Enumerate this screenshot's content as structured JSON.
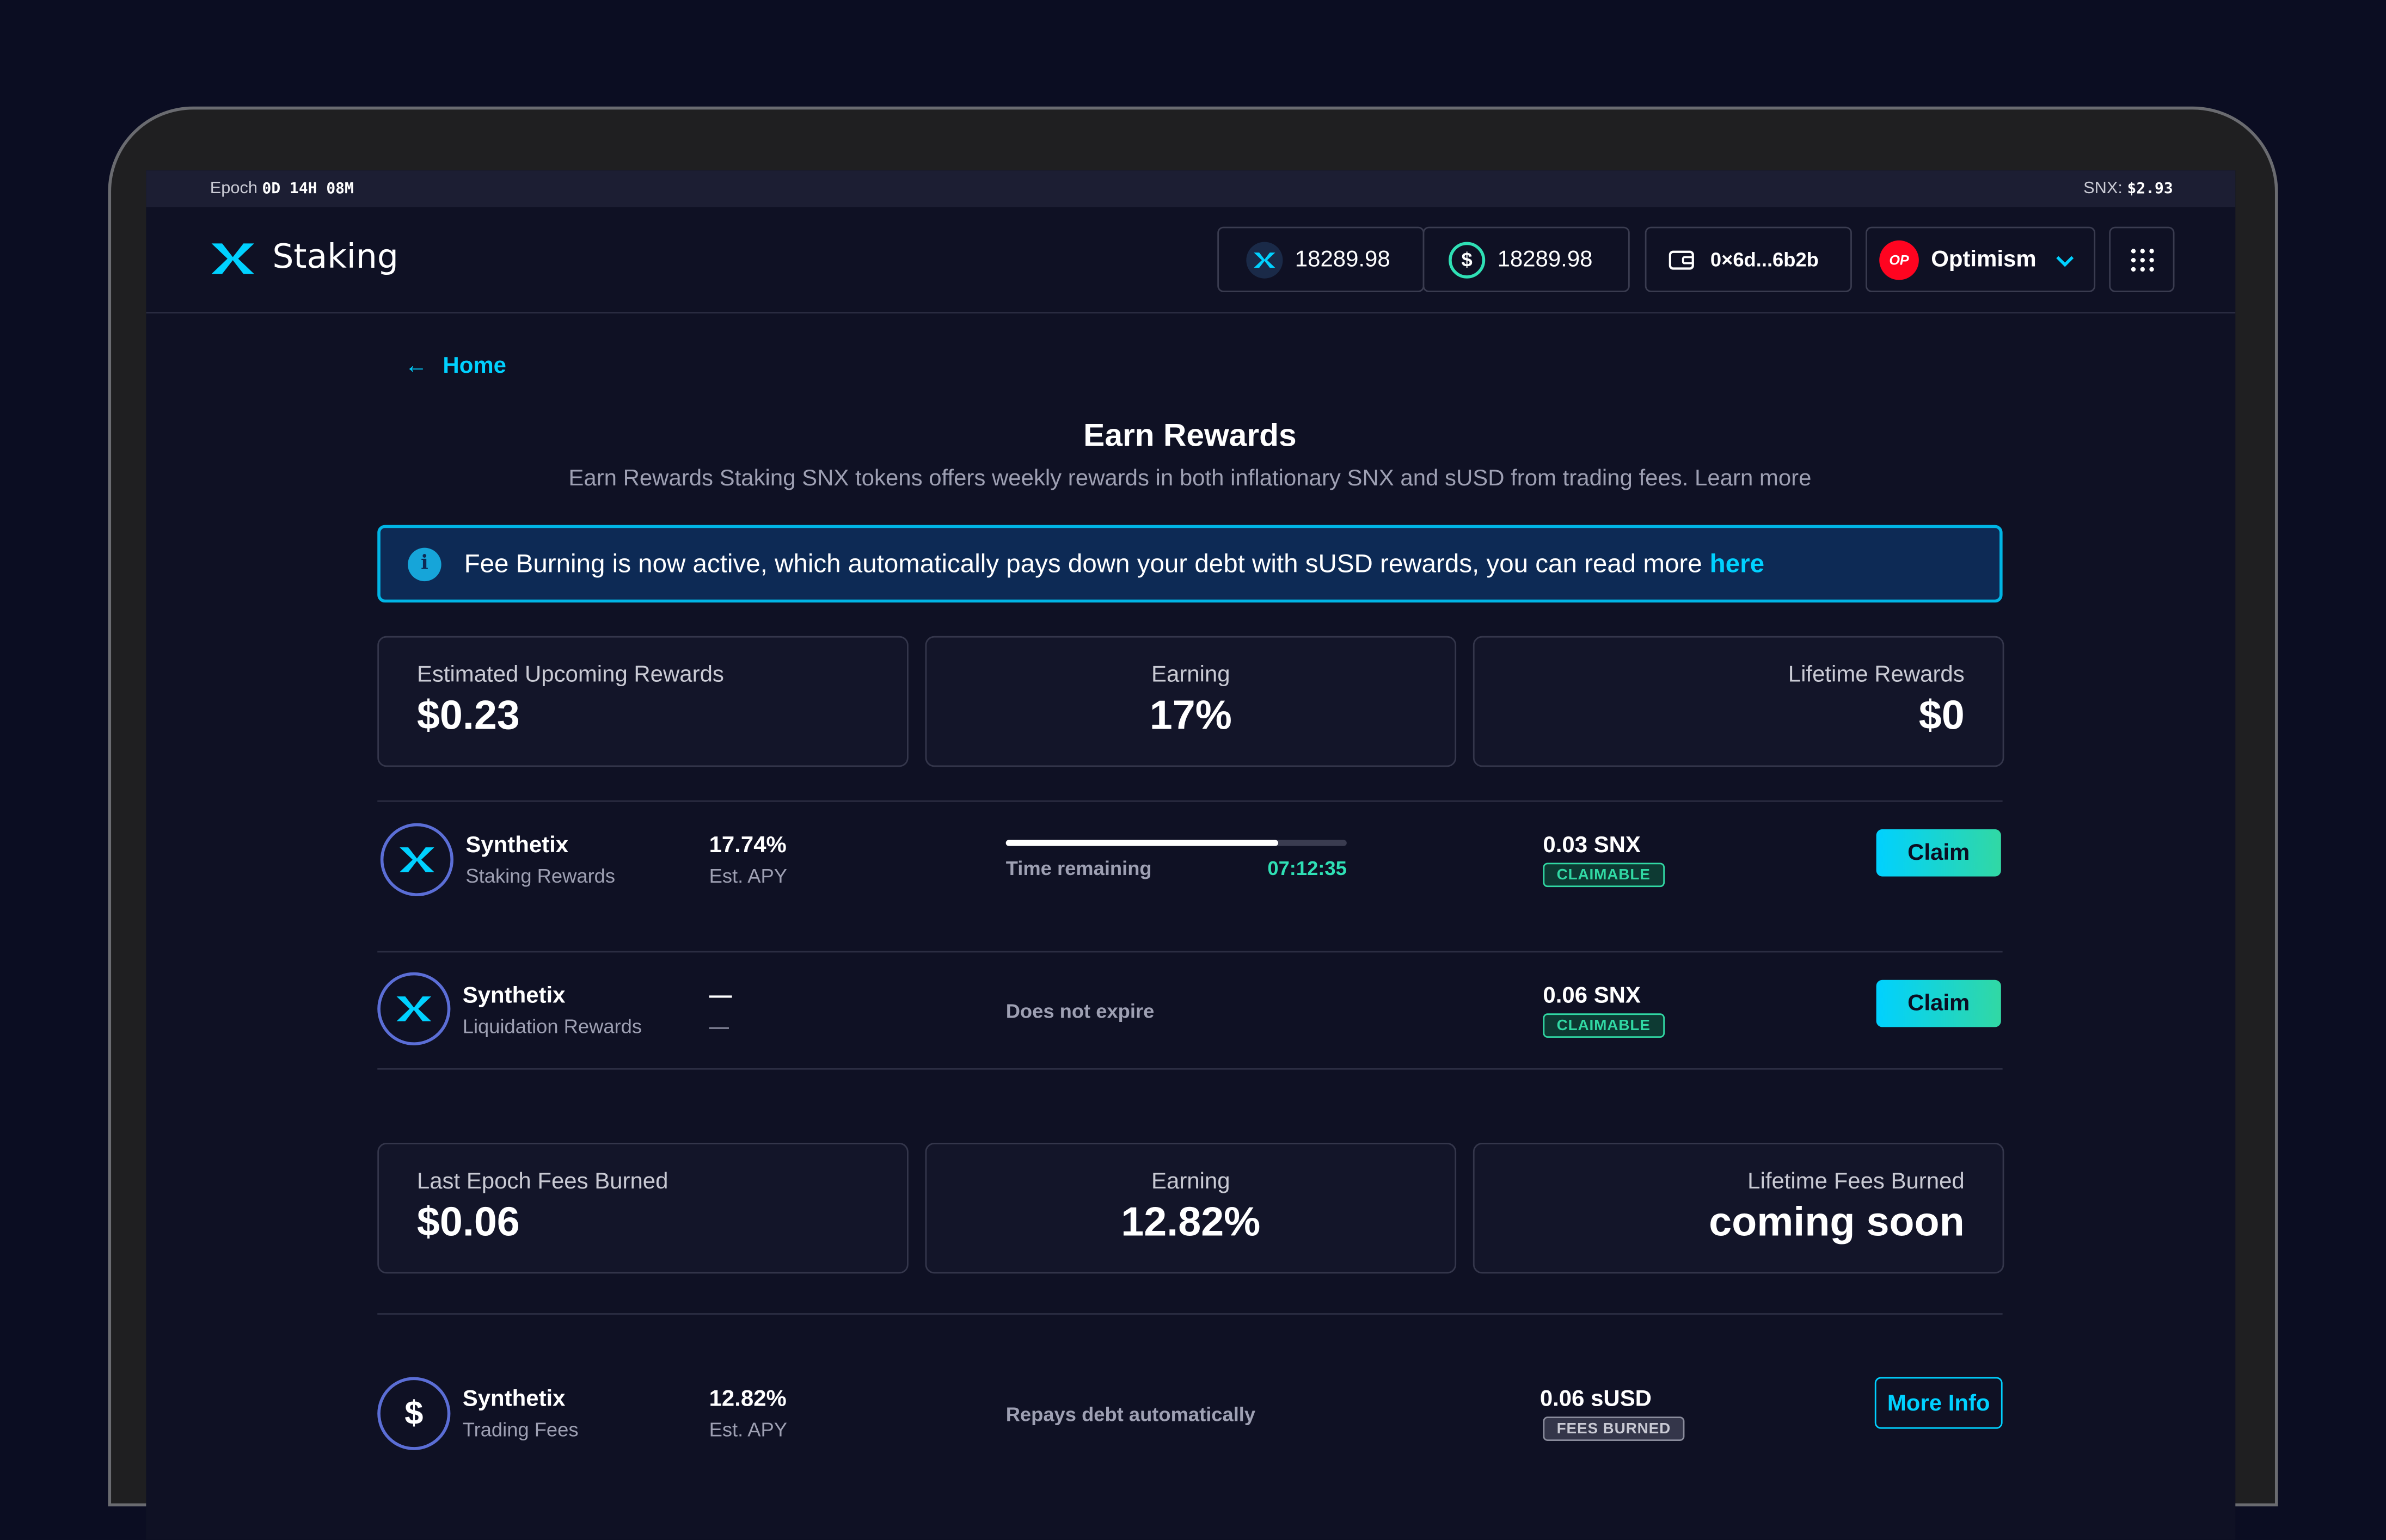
{
  "topbar": {
    "epoch_label": "Epoch",
    "epoch_value": "0D 14H 08M",
    "price_label": "SNX:",
    "price_value": "$2.93"
  },
  "header": {
    "app_name": "Staking",
    "snx_balance": "18289.98",
    "susd_balance": "18289.98",
    "wallet_address": "0×6d...6b2b",
    "network": "Optimism",
    "network_badge": "OP",
    "usd_symbol": "$"
  },
  "nav": {
    "back_label": "Home"
  },
  "page": {
    "title": "Earn Rewards",
    "subtitle": "Earn Rewards Staking SNX tokens offers weekly rewards in both inflationary SNX and sUSD from trading fees. Learn more"
  },
  "alert": {
    "icon": "i",
    "text": "Fee Burning is now active, which automatically pays down your debt with sUSD rewards, you can read more",
    "link": "here"
  },
  "rewards_cards": [
    {
      "label": "Estimated Upcoming Rewards",
      "value": "$0.23"
    },
    {
      "label": "Earning",
      "value": "17%"
    },
    {
      "label": "Lifetime Rewards",
      "value": "$0"
    }
  ],
  "reward_rows": [
    {
      "name": "Synthetix",
      "subtitle": "Staking Rewards",
      "apy": "17.74%",
      "apy_label": "Est. APY",
      "time_label": "Time remaining",
      "time_value": "07:12:35",
      "progress": 0.8,
      "amount": "0.03 SNX",
      "status": "CLAIMABLE",
      "action": "Claim"
    },
    {
      "name": "Synthetix",
      "subtitle": "Liquidation Rewards",
      "apy": "—",
      "apy_label": "—",
      "time_label": "Does not expire",
      "amount": "0.06 SNX",
      "status": "CLAIMABLE",
      "action": "Claim"
    }
  ],
  "fees_cards": [
    {
      "label": "Last Epoch Fees Burned",
      "value": "$0.06"
    },
    {
      "label": "Earning",
      "value": "12.82%"
    },
    {
      "label": "Lifetime Fees Burned",
      "value": "coming soon"
    }
  ],
  "fee_row": {
    "icon": "$",
    "name": "Synthetix",
    "subtitle": "Trading Fees",
    "apy": "12.82%",
    "apy_label": "Est. APY",
    "note": "Repays debt automatically",
    "amount": "0.06 sUSD",
    "status": "FEES BURNED",
    "action": "More Info"
  },
  "colors": {
    "accent_cyan": "#00d1ff",
    "accent_green": "#31d8a4",
    "background": "#0f1124"
  }
}
